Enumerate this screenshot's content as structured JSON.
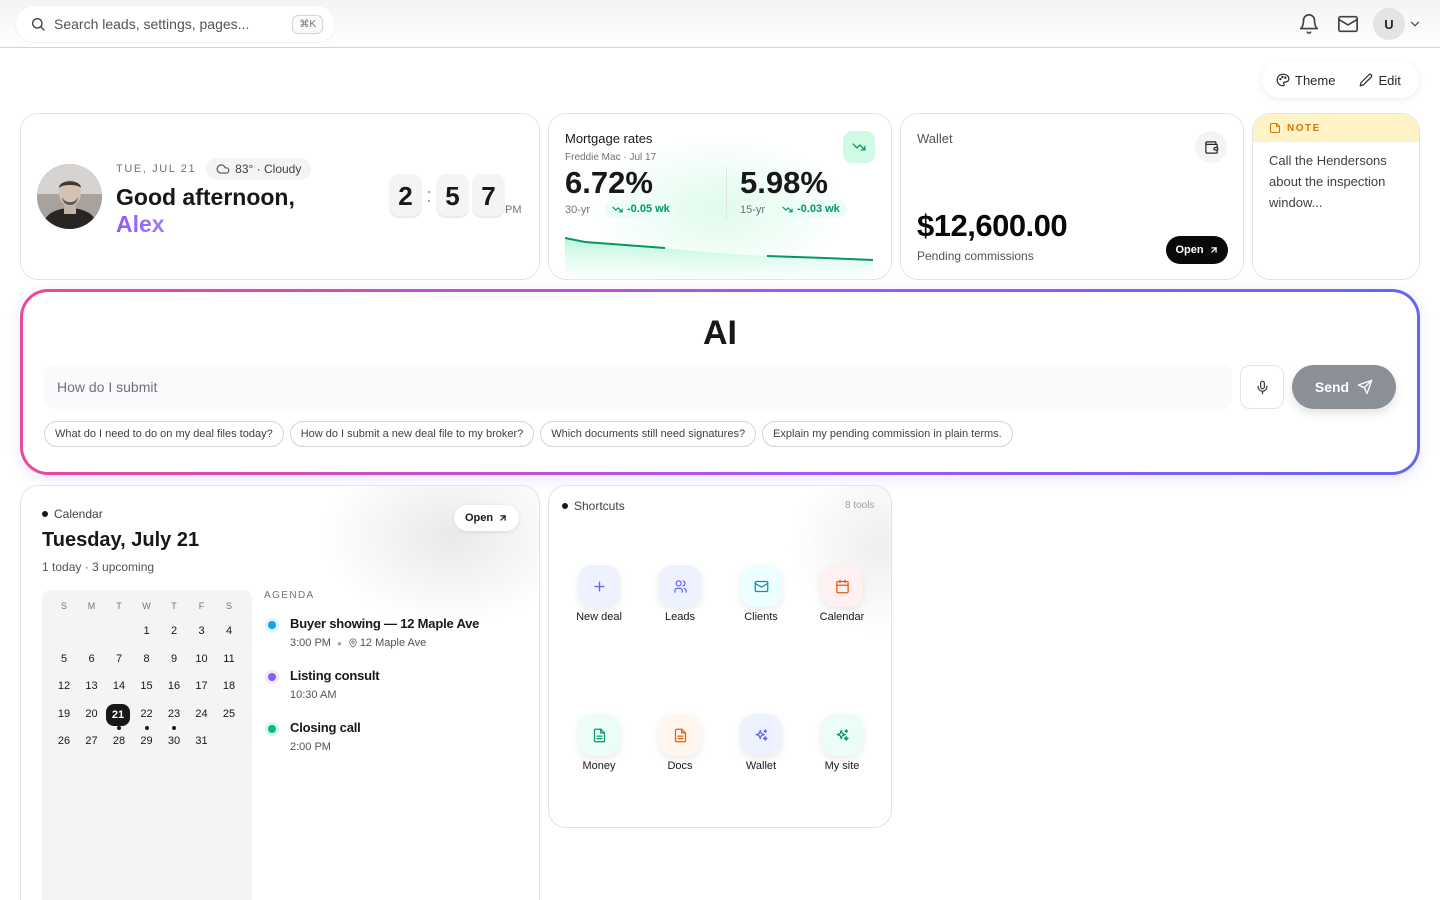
{
  "topbar": {
    "search_placeholder": "Search leads, settings, pages...",
    "search_shortcut": "⌘K",
    "avatar_initial": "U"
  },
  "toolbar": {
    "theme_label": "Theme",
    "edit_label": "Edit"
  },
  "greeting": {
    "date": "TUE, JUL 21",
    "weather": "83° · Cloudy",
    "line1": "Good afternoon,",
    "name": "Alex",
    "clock_h": "2",
    "clock_m1": "5",
    "clock_m2": "7",
    "ampm": "PM"
  },
  "mortgage": {
    "title": "Mortgage rates",
    "subtitle": "Freddie Mac · Jul 17",
    "rates": [
      {
        "value": "6.72%",
        "term": "30-yr",
        "change": "-0.05 wk"
      },
      {
        "value": "5.98%",
        "term": "15-yr",
        "change": "-0.03 wk"
      }
    ]
  },
  "wallet": {
    "title": "Wallet",
    "amount": "$12,600.00",
    "subtitle": "Pending commissions",
    "open_label": "Open"
  },
  "note": {
    "tag": "NOTE",
    "text": "Call the Hendersons about the inspection window..."
  },
  "ai": {
    "title": "AI",
    "input_value": "How do I submit",
    "send_label": "Send",
    "suggestions": [
      "What do I need to do on my deal files today?",
      "How do I submit a new deal file to my broker?",
      "Which documents still need signatures?",
      "Explain my pending commission in plain terms."
    ]
  },
  "calendar": {
    "label": "Calendar",
    "open_label": "Open",
    "date": "Tuesday, July 21",
    "count": "1 today · 3 upcoming",
    "weekdays": [
      "S",
      "M",
      "T",
      "W",
      "T",
      "F",
      "S"
    ],
    "days": [
      "1",
      "2",
      "3",
      "4",
      "5",
      "6",
      "7",
      "8",
      "9",
      "10",
      "11",
      "12",
      "13",
      "14",
      "15",
      "16",
      "17",
      "18",
      "19",
      "20",
      "21",
      "22",
      "23",
      "24",
      "25",
      "26",
      "27",
      "28",
      "29",
      "30",
      "31"
    ],
    "today": "21",
    "event_days": [
      "21",
      "22",
      "23"
    ],
    "agenda_label": "AGENDA",
    "agenda": [
      {
        "title": "Buyer showing — 12 Maple Ave",
        "time": "3:00 PM",
        "location": "12 Maple Ave",
        "color": "#0ea5e9"
      },
      {
        "title": "Listing consult",
        "time": "10:30 AM",
        "location": "",
        "color": "#8b5cf6"
      },
      {
        "title": "Closing call",
        "time": "2:00 PM",
        "location": "",
        "color": "#10b981"
      }
    ]
  },
  "shortcuts": {
    "label": "Shortcuts",
    "count": "8 tools",
    "items": [
      {
        "label": "New deal",
        "icon": "plus-icon"
      },
      {
        "label": "Leads",
        "icon": "users-icon"
      },
      {
        "label": "Clients",
        "icon": "mail-icon"
      },
      {
        "label": "Calendar",
        "icon": "calendar-icon"
      },
      {
        "label": "Money",
        "icon": "document-icon"
      },
      {
        "label": "Docs",
        "icon": "document-icon"
      },
      {
        "label": "Wallet",
        "icon": "sparkles-icon"
      },
      {
        "label": "My site",
        "icon": "sparkles-icon"
      }
    ]
  },
  "colors": {
    "accent_green": "#059669",
    "ai_gradient": [
      "#ec4899",
      "#a855f7",
      "#6366f1"
    ],
    "note_header": "#fef3c7",
    "send_button": "#8b8f97"
  }
}
